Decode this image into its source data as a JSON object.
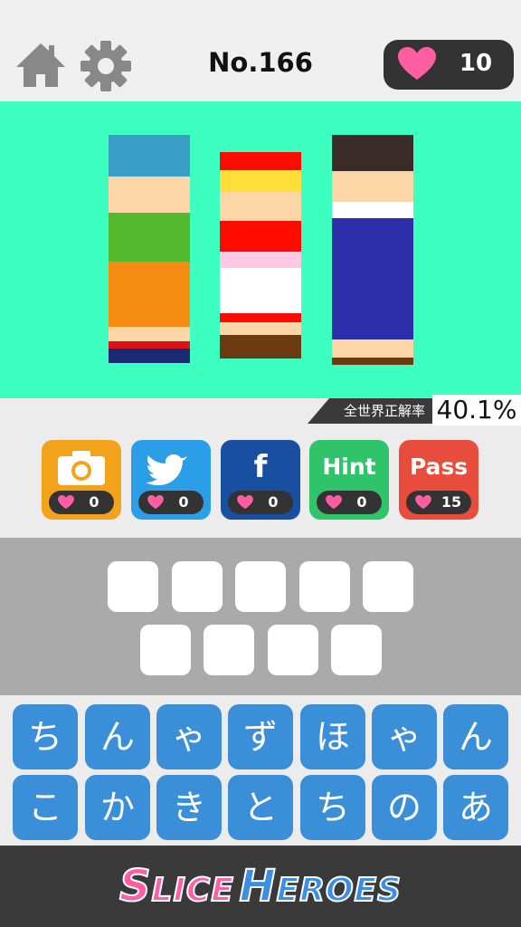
{
  "header": {
    "title": "No.166",
    "hearts": "10",
    "home_icon": "home-icon",
    "settings_icon": "gear-icon"
  },
  "puzzle": {
    "background": "#3cffc0",
    "strips": [
      {
        "bands": [
          "#3a9fc7",
          "#fdd6a8",
          "#53b92f",
          "#f58d13",
          "#fdd6a8",
          "#e0111b",
          "#1b2b73"
        ]
      },
      {
        "bands": [
          "#ff0a00",
          "#ffde3a",
          "#fdd6a8",
          "#ff0a00",
          "#ffc8e4",
          "#ffffff",
          "#ff0a00",
          "#fdd6a8",
          "#6b3a10"
        ]
      },
      {
        "bands": [
          "#3a2a28",
          "#fdd6a8",
          "#ffffff",
          "#2b2ea8",
          "#fdd6a8",
          "#6b3a10"
        ]
      }
    ]
  },
  "stats": {
    "rate_label": "全世界正解率",
    "rate_value": "40.1%"
  },
  "tools": [
    {
      "name": "camera",
      "label": "",
      "icon": "camera-icon",
      "cost": "0",
      "color": "#f3a21c"
    },
    {
      "name": "twitter",
      "label": "",
      "icon": "twitter-bird-icon",
      "cost": "0",
      "color": "#2c9ee8"
    },
    {
      "name": "facebook",
      "label": "f",
      "icon": "facebook-icon",
      "cost": "0",
      "color": "#194fa0"
    },
    {
      "name": "hint",
      "label": "Hint",
      "icon": "",
      "cost": "0",
      "color": "#2fc46a"
    },
    {
      "name": "pass",
      "label": "Pass",
      "icon": "",
      "cost": "15",
      "color": "#e74c3c"
    }
  ],
  "answer": {
    "row1_slots": 5,
    "row2_slots": 4
  },
  "keyboard": {
    "row1": [
      "ち",
      "ん",
      "ゃ",
      "ず",
      "ほ",
      "ゃ",
      "ん"
    ],
    "row2": [
      "こ",
      "か",
      "き",
      "と",
      "ち",
      "の",
      "あ"
    ]
  },
  "footer": {
    "logo_word1_initial": "S",
    "logo_word1_rest": "LICE",
    "logo_word2_initial": "H",
    "logo_word2_rest": "EROES"
  }
}
